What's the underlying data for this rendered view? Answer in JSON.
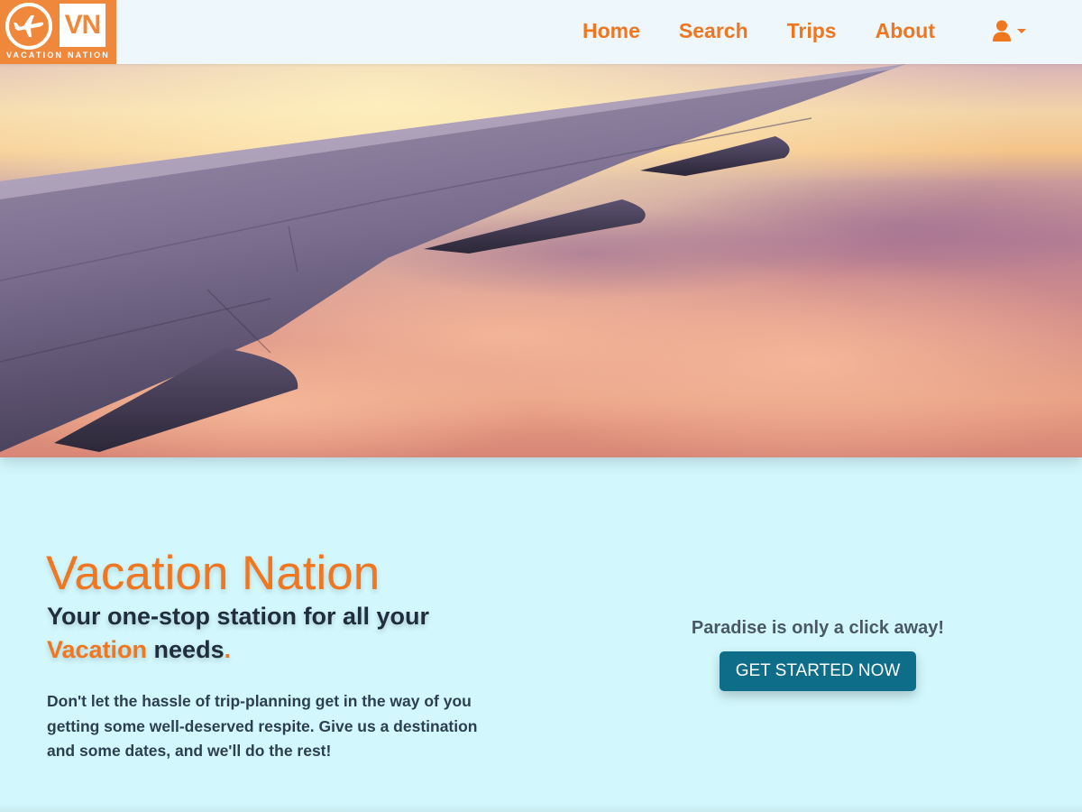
{
  "brand": {
    "logo_letters": "VN",
    "logo_subtitle": "VACATION NATION",
    "accent_color": "#f07620",
    "logo_bg": "#f0883c"
  },
  "nav": {
    "links": [
      "Home",
      "Search",
      "Trips",
      "About"
    ],
    "user_icon": "user-icon",
    "caret_icon": "caret-down-icon"
  },
  "hero": {
    "image": "airplane-wing-over-sunset-clouds"
  },
  "main": {
    "title": "Vacation Nation",
    "tagline_part1": "Your one-stop station for all your",
    "tagline_accent": "Vacation",
    "tagline_part2": " needs",
    "tagline_period": ".",
    "description": "Don't let the hassle of trip-planning get in the way of you getting some well-deserved respite. Give us a destination and some dates, and we'll do the rest!",
    "cta_text": "Paradise is only a click away!",
    "cta_button": "GET STARTED NOW",
    "button_color": "#0e6d89"
  }
}
